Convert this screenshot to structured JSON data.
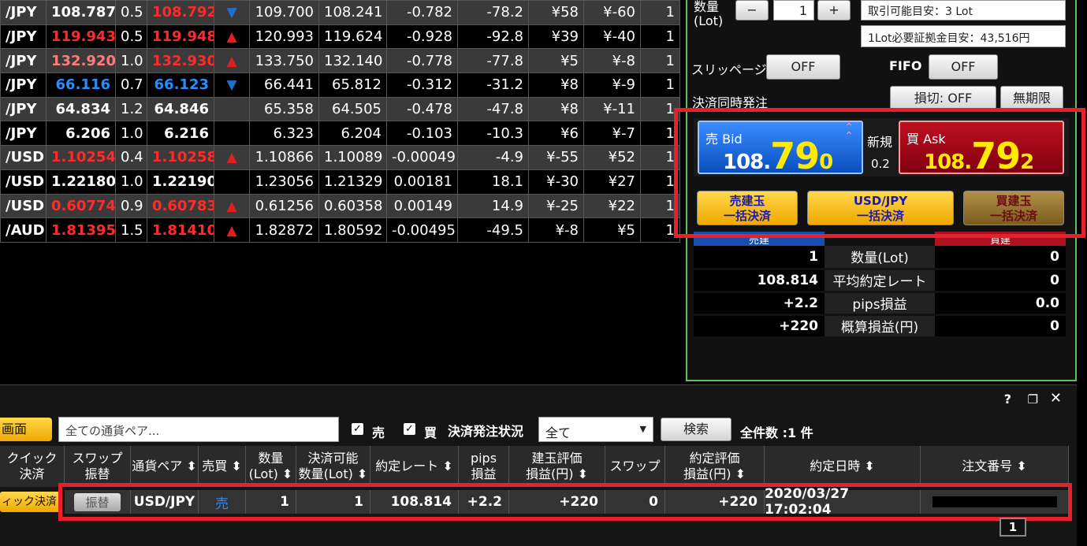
{
  "rates": [
    {
      "pair": "/JPY",
      "bid": "108.787",
      "spread": "0.5",
      "ask": "108.792",
      "dir": "down",
      "high": "109.700",
      "low": "108.241",
      "chg": "-0.782",
      "pips": "-78.2",
      "swap_sell": "¥58",
      "swap_buy": "¥-60",
      "lot": "1",
      "bid_color": "#ffffff",
      "ask_color": "#ff2a2a"
    },
    {
      "pair": "/JPY",
      "bid": "119.943",
      "spread": "0.5",
      "ask": "119.948",
      "dir": "up",
      "high": "120.993",
      "low": "119.624",
      "chg": "-0.928",
      "pips": "-92.8",
      "swap_sell": "¥39",
      "swap_buy": "¥-40",
      "lot": "1",
      "bid_color": "#ff2a2a",
      "ask_color": "#ff2a2a"
    },
    {
      "pair": "/JPY",
      "bid": "132.920",
      "spread": "1.0",
      "ask": "132.930",
      "dir": "up",
      "high": "133.750",
      "low": "132.140",
      "chg": "-0.778",
      "pips": "-77.8",
      "swap_sell": "¥5",
      "swap_buy": "¥-8",
      "lot": "1",
      "bid_color": "#ff7b7b",
      "ask_color": "#ff2a2a"
    },
    {
      "pair": "/JPY",
      "bid": "66.116",
      "spread": "0.7",
      "ask": "66.123",
      "dir": "down",
      "high": "66.441",
      "low": "65.812",
      "chg": "-0.312",
      "pips": "-31.2",
      "swap_sell": "¥8",
      "swap_buy": "¥-9",
      "lot": "1",
      "bid_color": "#2b8cff",
      "ask_color": "#2b8cff"
    },
    {
      "pair": "/JPY",
      "bid": "64.834",
      "spread": "1.2",
      "ask": "64.846",
      "dir": "",
      "high": "65.358",
      "low": "64.505",
      "chg": "-0.478",
      "pips": "-47.8",
      "swap_sell": "¥8",
      "swap_buy": "¥-11",
      "lot": "1",
      "bid_color": "#ffffff",
      "ask_color": "#ffffff"
    },
    {
      "pair": "/JPY",
      "bid": "6.206",
      "spread": "1.0",
      "ask": "6.216",
      "dir": "",
      "high": "6.323",
      "low": "6.204",
      "chg": "-0.103",
      "pips": "-10.3",
      "swap_sell": "¥6",
      "swap_buy": "¥-7",
      "lot": "1",
      "bid_color": "#ffffff",
      "ask_color": "#ffffff"
    },
    {
      "pair": "/USD",
      "bid": "1.10254",
      "spread": "0.4",
      "ask": "1.10258",
      "dir": "up",
      "high": "1.10866",
      "low": "1.10089",
      "chg": "-0.00049",
      "pips": "-4.9",
      "swap_sell": "¥-55",
      "swap_buy": "¥52",
      "lot": "1",
      "bid_color": "#ff2a2a",
      "ask_color": "#ff2a2a"
    },
    {
      "pair": "/USD",
      "bid": "1.22180",
      "spread": "1.0",
      "ask": "1.22190",
      "dir": "",
      "high": "1.23056",
      "low": "1.21329",
      "chg": "0.00181",
      "pips": "18.1",
      "swap_sell": "¥-30",
      "swap_buy": "¥27",
      "lot": "1",
      "bid_color": "#ffffff",
      "ask_color": "#ffffff"
    },
    {
      "pair": "/USD",
      "bid": "0.60774",
      "spread": "0.9",
      "ask": "0.60783",
      "dir": "up",
      "high": "0.61256",
      "low": "0.60358",
      "chg": "0.00149",
      "pips": "14.9",
      "swap_sell": "¥-25",
      "swap_buy": "¥22",
      "lot": "1",
      "bid_color": "#ff2a2a",
      "ask_color": "#ff2a2a"
    },
    {
      "pair": "/AUD",
      "bid": "1.81395",
      "spread": "1.5",
      "ask": "1.81410",
      "dir": "up",
      "high": "1.82872",
      "low": "1.80592",
      "chg": "-0.00495",
      "pips": "-49.5",
      "swap_sell": "¥-8",
      "swap_buy": "¥5",
      "lot": "1",
      "bid_color": "#ff2a2a",
      "ask_color": "#ff2a2a"
    }
  ],
  "order": {
    "qty_label": "数量\n(Lot)",
    "minus": "−",
    "qty_value": "1",
    "plus": "+",
    "available": "取引可能目安：3 Lot",
    "margin": "1Lot必要証拠金目安：43,516円",
    "slippage_label": "スリッページ",
    "slippage_value": "OFF",
    "fifo_label": "FIFO",
    "fifo_value": "OFF",
    "settle_label": "決済同時発注",
    "stop_value": "損切: OFF",
    "expiry_value": "無期限"
  },
  "quote": {
    "bid_label": "売 Bid",
    "bid_main": "108.",
    "bid_big": "79",
    "bid_small": "0",
    "new_label": "新規",
    "spread": "0.2",
    "ask_label": "買 Ask",
    "ask_main": "108.",
    "ask_big": "79",
    "ask_small": "2"
  },
  "settle_buttons": [
    {
      "line1": "売建玉",
      "line2": "一括決済"
    },
    {
      "line1": "USD/JPY",
      "line2": "一括決済"
    },
    {
      "line1": "買建玉",
      "line2": "一括決済"
    }
  ],
  "position": {
    "sell_header": "売建",
    "buy_header": "買建",
    "rows": [
      {
        "sell": "1",
        "label": "数量(Lot)",
        "buy": "0"
      },
      {
        "sell": "108.814",
        "label": "平均約定レート",
        "buy": "0"
      },
      {
        "sell": "+2.2",
        "label": "pips損益",
        "buy": "0.0"
      },
      {
        "sell": "+220",
        "label": "概算損益(円)",
        "buy": "0"
      }
    ]
  },
  "list": {
    "screen_btn": "画面",
    "pair_filter": "全ての通貨ペア...",
    "sell_check": "売",
    "buy_check": "買",
    "status_label": "決済発注状況",
    "status_value": "全て",
    "search_btn": "検索",
    "total": "全件数 :1 件",
    "headers": [
      "クイック\n決済",
      "スワップ\n振替",
      "通貨ペア ⬍",
      "売買 ⬍",
      "数量\n(Lot) ⬍",
      "決済可能\n数量(Lot) ⬍",
      "約定レート ⬍",
      "pips\n損益",
      "建玉評価\n損益(円) ⬍",
      "スワップ",
      "約定評価\n損益(円) ⬍",
      "約定日時 ⬍",
      "注文番号 ⬍"
    ],
    "row": {
      "quick": "ィック決済",
      "swap_btn": "振替",
      "pair": "USD/JPY",
      "side": "売",
      "qty": "1",
      "settleable": "1",
      "rate": "108.814",
      "pips": "+2.2",
      "eval": "+220",
      "swap": "0",
      "exec_eval": "+220",
      "datetime": "2020/03/27 17:02:04"
    },
    "page": "1"
  }
}
